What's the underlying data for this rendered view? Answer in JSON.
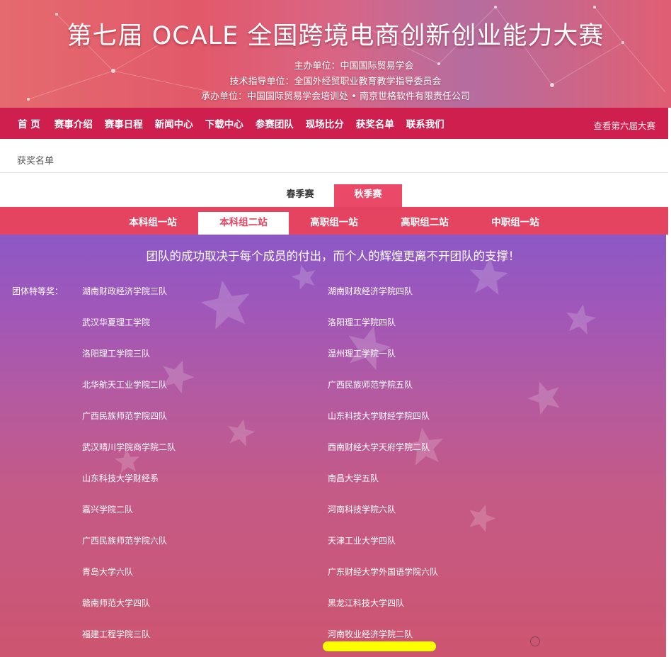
{
  "header": {
    "title": "第七届 OCALE 全国跨境电商创新创业能力大赛",
    "host": "主办单位：中国国际贸易学会",
    "guide": "技术指导单位：全国外经贸职业教育教学指导委员会",
    "organizer": "承办单位：中国国际贸易学会培训处 • 南京世格软件有限责任公司"
  },
  "nav": {
    "items": [
      "首 页",
      "赛事介绍",
      "赛事日程",
      "新闻中心",
      "下载中心",
      "参赛团队",
      "现场比分",
      "获奖名单",
      "联系我们"
    ],
    "right_link": "查看第六届大赛"
  },
  "breadcrumb": "获奖名单",
  "season_tabs": [
    {
      "label": "春季赛",
      "active": false
    },
    {
      "label": "秋季赛",
      "active": true
    }
  ],
  "group_tabs": [
    {
      "label": "本科组一站",
      "active": false
    },
    {
      "label": "本科组二站",
      "active": true
    },
    {
      "label": "高职组一站",
      "active": false
    },
    {
      "label": "高职组二站",
      "active": false
    },
    {
      "label": "中职组一站",
      "active": false
    }
  ],
  "slogan": "团队的成功取决于每个成员的付出，而个人的辉煌更离不开团队的支撑！",
  "award_label": "团体特等奖：",
  "teams_left": [
    "湖南财政经济学院三队",
    "武汉华夏理工学院",
    "洛阳理工学院三队",
    "北华航天工业学院二队",
    "广西民族师范学院四队",
    "武汉晴川学院商学院二队",
    "山东科技大学财经系",
    "嘉兴学院二队",
    "广西民族师范学院六队",
    "青岛大学六队",
    "赣南师范大学四队",
    "福建工程学院三队"
  ],
  "teams_right": [
    "湖南财政经济学院四队",
    "洛阳理工学院四队",
    "温州理工学院一队",
    "广西民族师范学院五队",
    "山东科技大学财经学院四队",
    "西南财经大学天府学院二队",
    "南昌大学五队",
    "河南科技学院六队",
    "天津工业大学四队",
    "广东财经大学外国语学院六队",
    "黑龙江科技大学四队",
    "河南牧业经济学院二队"
  ],
  "colors": {
    "nav_bg": "#cf1f4e",
    "tab_active": "#ea4a68",
    "highlight": "#ffff00"
  }
}
